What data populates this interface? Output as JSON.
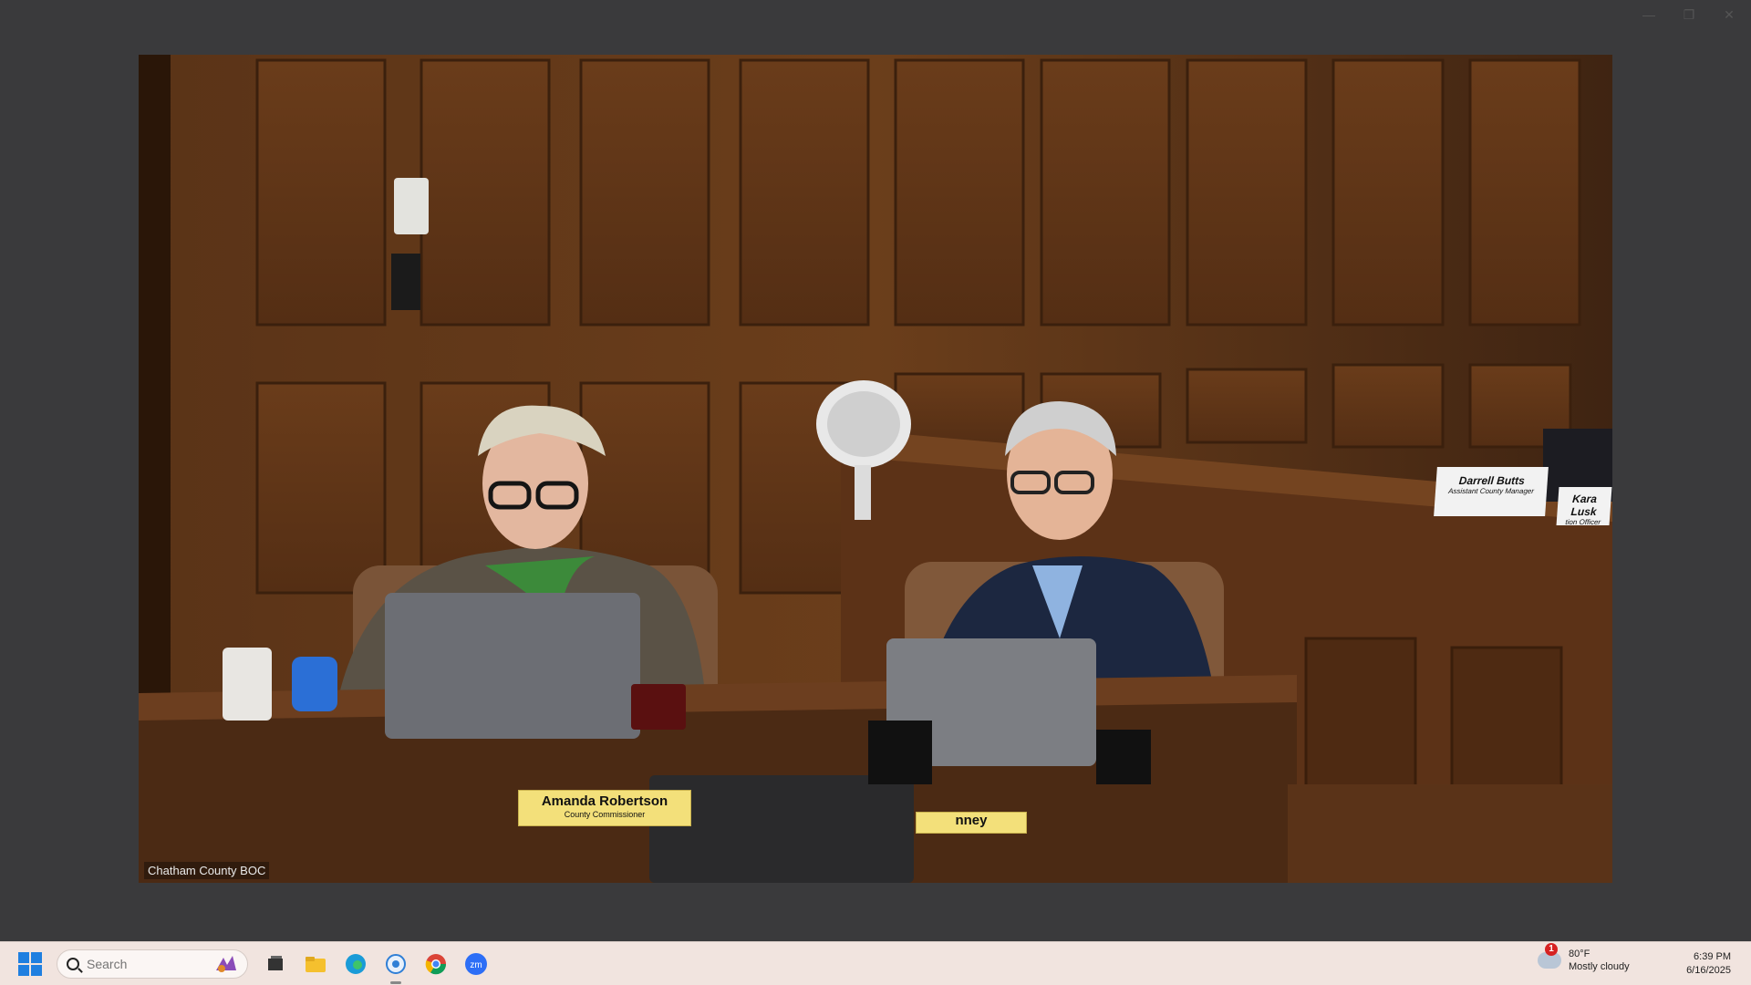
{
  "window": {
    "minimize": "—",
    "restore": "❐",
    "close": "✕"
  },
  "video": {
    "caption": "Chatham County BOC",
    "nameplate_left": {
      "name": "Amanda Robertson",
      "title": "County Commissioner"
    },
    "nameplate_right": {
      "name": "nney"
    },
    "back_plate_1": {
      "name": "Darrell Butts",
      "title": "Assistant County Manager"
    },
    "back_plate_2": {
      "name": "Kara Lusk",
      "title": "tion Officer"
    }
  },
  "taskbar": {
    "search_placeholder": "Search",
    "weather": {
      "badge": "1",
      "temp": "80°F",
      "condition": "Mostly cloudy"
    },
    "clock": {
      "time": "6:39 PM",
      "date": "6/16/2025"
    }
  }
}
